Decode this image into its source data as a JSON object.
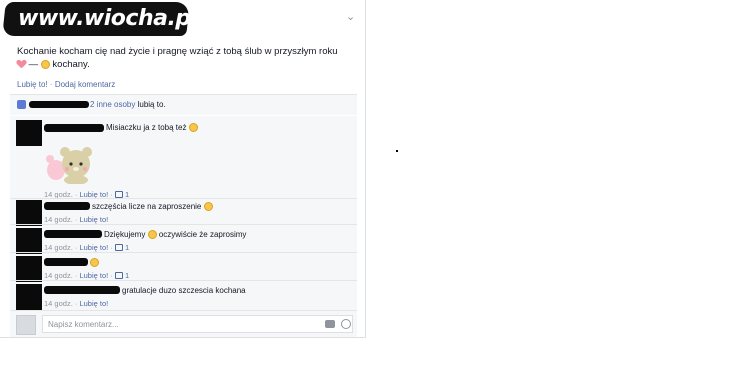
{
  "watermark": {
    "text": "www.wiocha.pl"
  },
  "post": {
    "line1": "Kochanie kocham cię nad życie i pragnę wziąć z tobą ślub w przyszłym roku",
    "line2_sep": " — ",
    "line2_tail": " kochany."
  },
  "actions": {
    "like": "Lubię to!",
    "dot": " · ",
    "comment": "Dodaj komentarz"
  },
  "likes": {
    "text_link": "2 inne osoby",
    "text_plain": " lubią to."
  },
  "comments": [
    {
      "text": "Misiaczku ja z tobą też",
      "time": "14 godz.",
      "like": "Lubię to!",
      "count": "1",
      "has_sticker": true
    },
    {
      "text": "szczęścia licze na zaproszenie",
      "time": "14 godz.",
      "like": "Lubię to!"
    },
    {
      "text": "Dziękujemy",
      "text2": "oczywiście że zaprosimy",
      "time": "14 godz.",
      "like": "Lubię to!",
      "count": "1"
    },
    {
      "text": "",
      "time": "14 godz.",
      "like": "Lubię to!",
      "count": "1"
    },
    {
      "text": "gratulacje duzo szczescia kochana",
      "time": "14 godz.",
      "like": "Lubię to!"
    }
  ],
  "composer": {
    "placeholder": "Napisz komentarz..."
  },
  "colors": {
    "link": "#4e69a2",
    "meta": "#90949c",
    "panel": "#f6f7f9"
  },
  "icons": [
    "chevron-down-icon",
    "thumb-up-icon",
    "camera-icon",
    "emoji-icon",
    "heart-emoji",
    "smile-emoji",
    "bear-sticker"
  ]
}
